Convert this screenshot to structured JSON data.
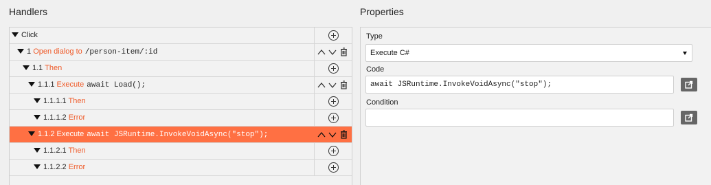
{
  "handlers": {
    "title": "Handlers",
    "rows": [
      {
        "num": "",
        "keyword": "",
        "label": "Click",
        "code": "",
        "actions": "add",
        "selected": false
      },
      {
        "num": "1",
        "keyword": "Open dialog to",
        "label": "",
        "code": "/person-item/:id",
        "actions": "move",
        "selected": false
      },
      {
        "num": "1.1",
        "keyword": "Then",
        "label": "",
        "code": "",
        "actions": "add",
        "selected": false
      },
      {
        "num": "1.1.1",
        "keyword": "Execute",
        "label": "",
        "code": "await Load();",
        "actions": "move",
        "selected": false
      },
      {
        "num": "1.1.1.1",
        "keyword": "Then",
        "label": "",
        "code": "",
        "actions": "add",
        "selected": false
      },
      {
        "num": "1.1.1.2",
        "keyword": "Error",
        "label": "",
        "code": "",
        "actions": "add",
        "selected": false
      },
      {
        "num": "1.1.2",
        "keyword": "Execute",
        "label": "",
        "code": "await JSRuntime.InvokeVoidAsync(\"stop\");",
        "actions": "move",
        "selected": true
      },
      {
        "num": "1.1.2.1",
        "keyword": "Then",
        "label": "",
        "code": "",
        "actions": "add",
        "selected": false
      },
      {
        "num": "1.1.2.2",
        "keyword": "Error",
        "label": "",
        "code": "",
        "actions": "add",
        "selected": false
      }
    ]
  },
  "properties": {
    "title": "Properties",
    "type_label": "Type",
    "type_value": "Execute C#",
    "code_label": "Code",
    "code_value": "await JSRuntime.InvokeVoidAsync(\"stop\");",
    "condition_label": "Condition",
    "condition_value": ""
  },
  "icons": {
    "tree_toggle": "triangle-down-icon",
    "add": "plus-circle-icon",
    "move_up": "chevron-up-icon",
    "move_down": "chevron-down-icon",
    "delete": "trash-icon",
    "open_editor": "external-link-icon"
  },
  "colors": {
    "accent": "#ef5a28",
    "selected_row": "#ff7043"
  }
}
